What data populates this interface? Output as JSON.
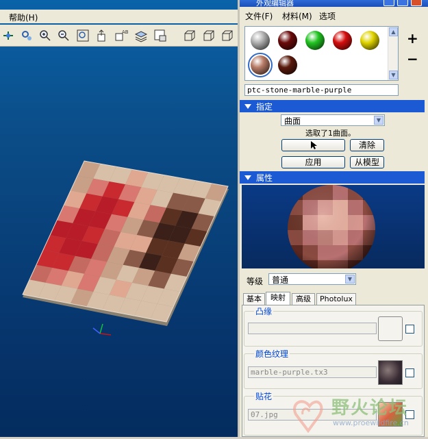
{
  "menubar": {
    "help": "帮助(H)"
  },
  "toolbar": {
    "icons": [
      "datum-display-icon",
      "repaint-icon",
      "zoom-in-icon",
      "zoom-out-icon",
      "refit-icon",
      "orient-icon",
      "saved-view-icon",
      "layer-icon",
      "model-setup-icon",
      "wireframe-icon",
      "hidden-line-icon",
      "no-hidden-icon",
      "shading-icon"
    ]
  },
  "panel": {
    "title": "外观编辑器",
    "menu": {
      "file": "文件(F)",
      "material": "材料(M)",
      "options": "选项"
    },
    "swatches": [
      {
        "color": "#b0b0b0",
        "name": "gray"
      },
      {
        "color": "#6a0a0a",
        "name": "dark-red"
      },
      {
        "color": "#22c422",
        "name": "green"
      },
      {
        "color": "#d40e0e",
        "name": "red"
      },
      {
        "color": "#e0d400",
        "name": "yellow"
      },
      {
        "color": "#b77b66",
        "name": "marble"
      },
      {
        "color": "#5a1a0c",
        "name": "brown"
      }
    ],
    "material_name": "ptc-stone-marble-purple",
    "add": "+",
    "remove": "−",
    "assign": {
      "header": "指定",
      "type": "曲面",
      "status": "选取了1曲面。",
      "clear": "清除",
      "apply": "应用",
      "from_model": "从模型"
    },
    "properties": {
      "header": "属性",
      "level_label": "等级",
      "level_value": "普通",
      "tabs": [
        "基本",
        "映射",
        "高级",
        "Photolux"
      ],
      "active_tab": "映射",
      "bump": {
        "label": "凸缘"
      },
      "color_texture": {
        "label": "颜色纹理",
        "file": "marble-purple.tx3"
      },
      "decal": {
        "label": "贴花",
        "file": "07.jpg"
      }
    }
  },
  "watermark": {
    "text": "野火论坛",
    "url": "www.proewildfire.cn"
  }
}
